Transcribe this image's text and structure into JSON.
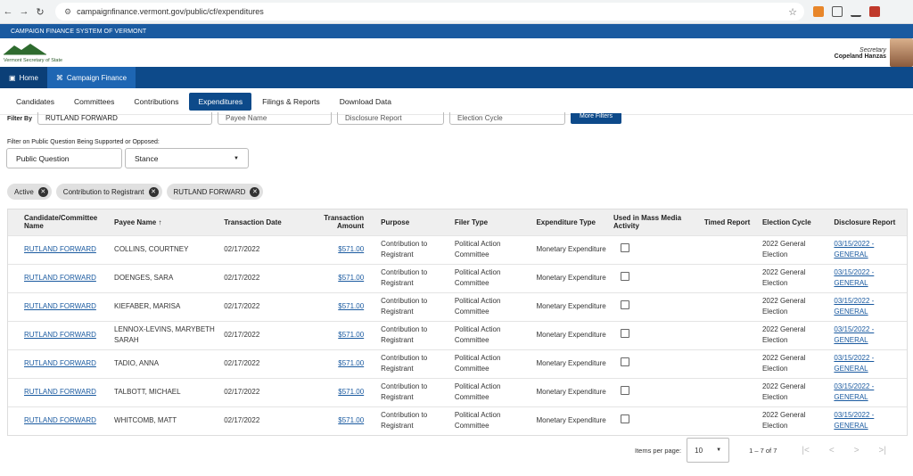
{
  "browser": {
    "url": "campaignfinance.vermont.gov/public/cf/expenditures"
  },
  "site": {
    "topbar": "CAMPAIGN FINANCE SYSTEM OF VERMONT",
    "logo_text": "Vermont Secretary of State",
    "secretary_title": "Secretary",
    "secretary_name": "Copeland Hanzas"
  },
  "navbar": {
    "home": "Home",
    "campaign_finance": "Campaign Finance"
  },
  "tabs": [
    {
      "label": "Candidates"
    },
    {
      "label": "Committees"
    },
    {
      "label": "Contributions"
    },
    {
      "label": "Expenditures",
      "active": true
    },
    {
      "label": "Filings & Reports"
    },
    {
      "label": "Download Data"
    }
  ],
  "filters": {
    "filter_by_label": "Filter By",
    "committee_value": "RUTLAND FORWARD",
    "payee_placeholder": "Payee Name",
    "disclosure_placeholder": "Disclosure Report",
    "cycle_placeholder": "Election Cycle",
    "more_filters": "More Filters",
    "public_question_label": "Filter on Public Question Being Supported or Opposed:",
    "public_question_placeholder": "Public Question",
    "stance_placeholder": "Stance"
  },
  "chips": [
    "Active",
    "Contribution to Registrant",
    "RUTLAND FORWARD"
  ],
  "table": {
    "headers": {
      "committee": "Candidate/Committee Name",
      "payee": "Payee Name",
      "date": "Transaction Date",
      "amount": "Transaction Amount",
      "purpose": "Purpose",
      "filer": "Filer Type",
      "exptype": "Expenditure Type",
      "mass_media": "Used in Mass Media Activity",
      "timed": "Timed Report",
      "cycle": "Election Cycle",
      "report": "Disclosure Report"
    },
    "rows": [
      {
        "committee": "RUTLAND FORWARD",
        "payee": "COLLINS, COURTNEY",
        "date": "02/17/2022",
        "amount": "$571.00",
        "purpose": "Contribution to Registrant",
        "filer": "Political Action Committee",
        "exptype": "Monetary Expenditure",
        "mass_media": false,
        "timed": "",
        "cycle": "2022 General Election",
        "report": "03/15/2022 - GENERAL"
      },
      {
        "committee": "RUTLAND FORWARD",
        "payee": "DOENGES, SARA",
        "date": "02/17/2022",
        "amount": "$571.00",
        "purpose": "Contribution to Registrant",
        "filer": "Political Action Committee",
        "exptype": "Monetary Expenditure",
        "mass_media": false,
        "timed": "",
        "cycle": "2022 General Election",
        "report": "03/15/2022 - GENERAL"
      },
      {
        "committee": "RUTLAND FORWARD",
        "payee": "KIEFABER, MARISA",
        "date": "02/17/2022",
        "amount": "$571.00",
        "purpose": "Contribution to Registrant",
        "filer": "Political Action Committee",
        "exptype": "Monetary Expenditure",
        "mass_media": false,
        "timed": "",
        "cycle": "2022 General Election",
        "report": "03/15/2022 - GENERAL"
      },
      {
        "committee": "RUTLAND FORWARD",
        "payee": "LENNOX-LEVINS, MARYBETH SARAH",
        "date": "02/17/2022",
        "amount": "$571.00",
        "purpose": "Contribution to Registrant",
        "filer": "Political Action Committee",
        "exptype": "Monetary Expenditure",
        "mass_media": false,
        "timed": "",
        "cycle": "2022 General Election",
        "report": "03/15/2022 - GENERAL"
      },
      {
        "committee": "RUTLAND FORWARD",
        "payee": "TADIO, ANNA",
        "date": "02/17/2022",
        "amount": "$571.00",
        "purpose": "Contribution to Registrant",
        "filer": "Political Action Committee",
        "exptype": "Monetary Expenditure",
        "mass_media": false,
        "timed": "",
        "cycle": "2022 General Election",
        "report": "03/15/2022 - GENERAL"
      },
      {
        "committee": "RUTLAND FORWARD",
        "payee": "TALBOTT, MICHAEL",
        "date": "02/17/2022",
        "amount": "$571.00",
        "purpose": "Contribution to Registrant",
        "filer": "Political Action Committee",
        "exptype": "Monetary Expenditure",
        "mass_media": false,
        "timed": "",
        "cycle": "2022 General Election",
        "report": "03/15/2022 - GENERAL"
      },
      {
        "committee": "RUTLAND FORWARD",
        "payee": "WHITCOMB, MATT",
        "date": "02/17/2022",
        "amount": "$571.00",
        "purpose": "Contribution to Registrant",
        "filer": "Political Action Committee",
        "exptype": "Monetary Expenditure",
        "mass_media": false,
        "timed": "",
        "cycle": "2022 General Election",
        "report": "03/15/2022 - GENERAL"
      }
    ]
  },
  "pager": {
    "items_per_page_label": "Items per page:",
    "items_per_page": "10",
    "range": "1 – 7 of 7"
  }
}
